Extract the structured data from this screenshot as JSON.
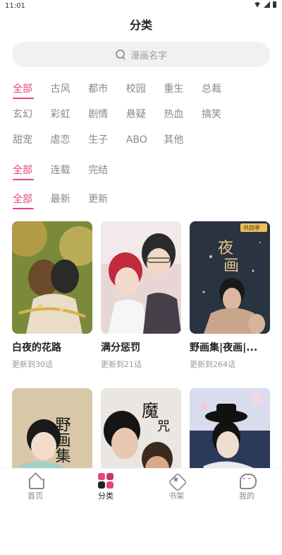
{
  "status_bar": {
    "time": "11:01"
  },
  "header": {
    "title": "分类"
  },
  "search": {
    "placeholder": "漫画名字"
  },
  "filters": {
    "genre": [
      "全部",
      "古风",
      "都市",
      "校园",
      "重生",
      "总裁",
      "玄幻",
      "彩虹",
      "剧情",
      "悬疑",
      "热血",
      "搞笑",
      "甜宠",
      "虐恋",
      "生子",
      "ABO",
      "其他"
    ],
    "genre_active": "全部",
    "status": [
      "全部",
      "连载",
      "完结"
    ],
    "status_active": "全部",
    "sort": [
      "全部",
      "最新",
      "更新"
    ],
    "sort_active": "全部"
  },
  "comics": [
    {
      "title": "白夜的花路",
      "update": "更新到30话"
    },
    {
      "title": "满分惩罚",
      "update": "更新到21话"
    },
    {
      "title": "野画集|夜画|...",
      "update": "更新到264话"
    },
    {
      "title": "",
      "update": ""
    },
    {
      "title": "",
      "update": ""
    },
    {
      "title": "",
      "update": ""
    }
  ],
  "cover_art": [
    {
      "scene": "golden-forest",
      "bg": "#c9a24a",
      "accent": "#2a2a2a"
    },
    {
      "scene": "pink-office",
      "bg": "#e8d6d6",
      "accent": "#c02a3a"
    },
    {
      "scene": "night-portrait",
      "bg": "#2a3340",
      "accent": "#e6c78a",
      "logo": "夜画",
      "badge": "共四季"
    },
    {
      "scene": "sketch-cover",
      "bg": "#d9c8a8",
      "accent": "#1a1a1a",
      "logo": "野画集"
    },
    {
      "scene": "dark-duo",
      "bg": "#3a3330",
      "accent": "#f2f2f2",
      "logo": "魔咒"
    },
    {
      "scene": "blue-hanbok",
      "bg": "#2c3a5a",
      "accent": "#e9e9f2"
    }
  ],
  "tabs": [
    {
      "label": "首页",
      "icon": "home-icon"
    },
    {
      "label": "分类",
      "icon": "category-icon",
      "active": true
    },
    {
      "label": "书架",
      "icon": "bookshelf-icon"
    },
    {
      "label": "我的",
      "icon": "profile-icon"
    }
  ],
  "colors": {
    "accent": "#e8457a",
    "muted": "#888888",
    "search_bg": "#f1f1f3"
  }
}
